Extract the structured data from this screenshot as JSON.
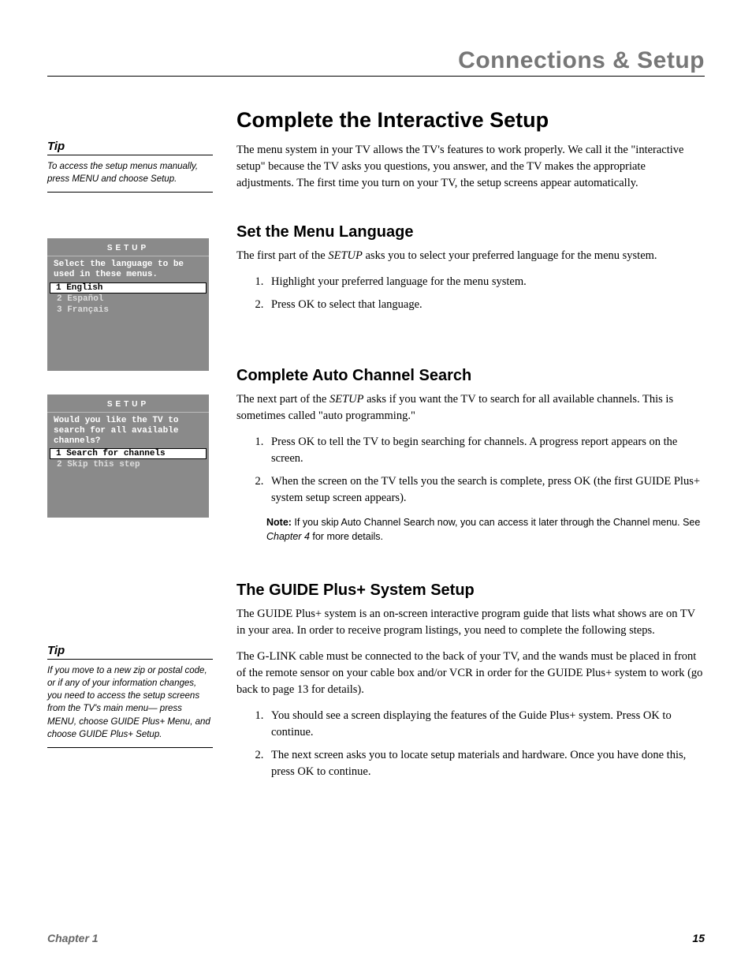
{
  "header": "Connections & Setup",
  "tip1": {
    "title": "Tip",
    "text": "To access the setup menus manually, press MENU and choose Setup."
  },
  "screen1": {
    "title": "SETUP",
    "prompt": "Select the language to be used in these menus.",
    "opt1": "1 English",
    "opt2": "2 Español",
    "opt3": "3 Français"
  },
  "screen2": {
    "title": "SETUP",
    "prompt": "Would you like the TV to search for all available channels?",
    "opt1": "1 Search for channels",
    "opt2": "2 Skip this step"
  },
  "tip2": {
    "title": "Tip",
    "text": "If you move to a new zip or postal code, or if any of your information changes, you need to access the setup screens from the TV's main menu— press MENU, choose GUIDE Plus+ Menu, and choose GUIDE Plus+ Setup."
  },
  "main": {
    "h1": "Complete the Interactive Setup",
    "intro": "The menu system in your TV allows the TV's features to work properly. We call it the \"interactive setup\" because the TV asks you questions, you answer, and the TV makes the appropriate adjustments. The first time you turn on your TV, the setup screens appear automatically.",
    "sec1_h": "Set the Menu Language",
    "sec1_p_a": "The first part of the ",
    "sec1_p_b": "SETUP",
    "sec1_p_c": " asks you to select your preferred language for the menu system.",
    "sec1_li1": "Highlight your preferred language for the menu system.",
    "sec1_li2": "Press OK to select that language.",
    "sec2_h": "Complete Auto Channel Search",
    "sec2_p_a": "The next part of the ",
    "sec2_p_b": "SETUP",
    "sec2_p_c": " asks if you want the TV to search for all available channels. This is sometimes called \"auto programming.\"",
    "sec2_li1": "Press OK to tell the TV to begin searching for channels. A progress report appears on the screen.",
    "sec2_li2": "When the screen on the TV tells you the search is complete, press OK (the first GUIDE Plus+ system setup screen appears).",
    "note_label": "Note:",
    "note_a": "  If you skip Auto Channel Search now, you can access it later through the Channel menu. See ",
    "note_b": "Chapter 4",
    "note_c": " for more details.",
    "sec3_h": "The GUIDE Plus+ System Setup",
    "sec3_p1": "The GUIDE Plus+ system is an on-screen interactive program guide that lists what shows are on TV in your area. In order to receive program listings, you need to complete the following steps.",
    "sec3_p2": "The G-LINK cable must be connected to the back of your TV, and the wands must be placed in front of the remote sensor on your cable box and/or VCR in order for the GUIDE Plus+ system to work (go back to page 13 for details).",
    "sec3_li1": "You should see a screen displaying the features of the Guide Plus+ system. Press OK to continue.",
    "sec3_li2": "The next screen asks you to locate setup materials and hardware. Once you have done this, press OK to continue."
  },
  "footer": {
    "left": "Chapter 1",
    "right": "15"
  }
}
